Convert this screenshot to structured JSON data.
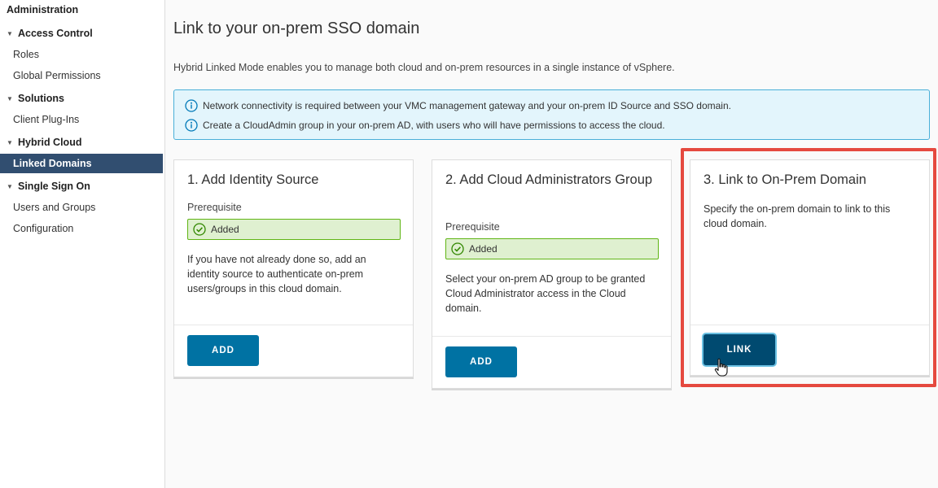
{
  "sidebar": {
    "title": "Administration",
    "groups": [
      {
        "label": "Access Control",
        "items": [
          "Roles",
          "Global Permissions"
        ]
      },
      {
        "label": "Solutions",
        "items": [
          "Client Plug-Ins"
        ]
      },
      {
        "label": "Hybrid Cloud",
        "items": [
          "Linked Domains"
        ]
      },
      {
        "label": "Single Sign On",
        "items": [
          "Users and Groups",
          "Configuration"
        ]
      }
    ],
    "active_item": "Linked Domains"
  },
  "main": {
    "title": "Link to your on-prem SSO domain",
    "description": "Hybrid Linked Mode enables you to manage both cloud and on-prem resources in a single instance of vSphere.",
    "alerts": [
      "Network connectivity is required between your VMC management gateway and your on-prem ID Source and SSO domain.",
      "Create a CloudAdmin group in your on-prem AD, with users who will have permissions to access the cloud."
    ],
    "cards": [
      {
        "title": "1. Add Identity Source",
        "prerequisite_label": "Prerequisite",
        "status": "Added",
        "text": "If you have not already done so, add an identity source to authenticate on-prem users/groups in this cloud domain.",
        "button": "ADD"
      },
      {
        "title": "2. Add Cloud Administrators Group",
        "prerequisite_label": "Prerequisite",
        "status": "Added",
        "text": "Select your on-prem AD group to be granted Cloud Administrator access in the Cloud domain.",
        "button": "ADD"
      },
      {
        "title": "3. Link to On-Prem Domain",
        "text": "Specify the on-prem domain to link to this cloud domain.",
        "button": "LINK"
      }
    ]
  },
  "colors": {
    "accent": "#0072a3",
    "active_nav": "#314e70",
    "info_border": "#49afd9",
    "success_border": "#60b515",
    "highlight": "#e5493f"
  },
  "icons": [
    "caret-down-icon",
    "info-icon",
    "check-circle-icon",
    "hand-pointer-icon"
  ]
}
